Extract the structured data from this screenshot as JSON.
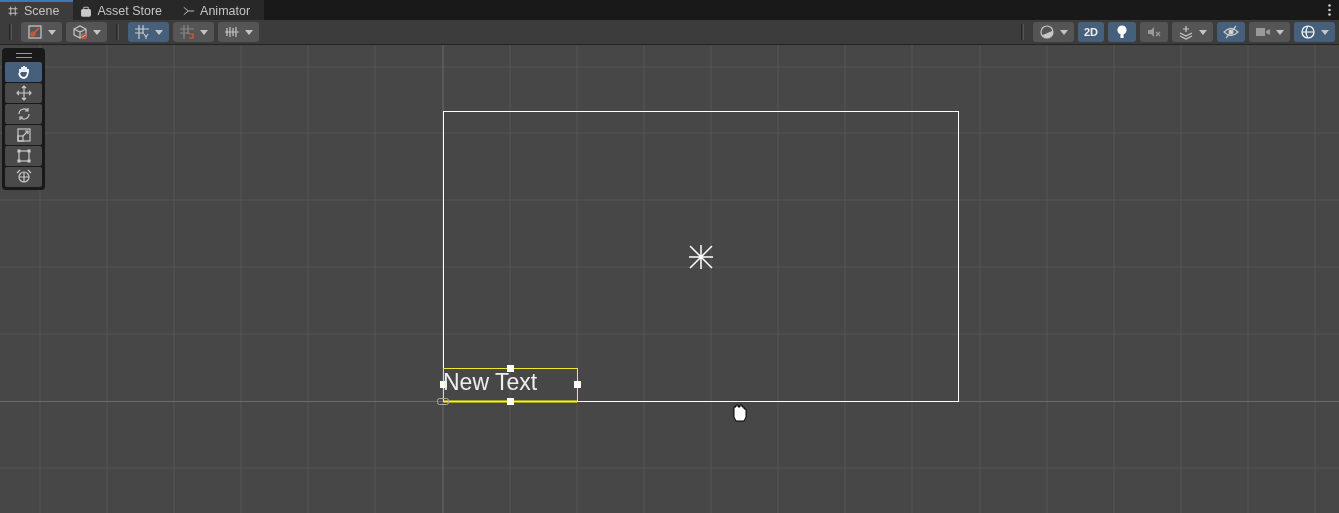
{
  "tabs": [
    {
      "label": "Scene",
      "selected": true
    },
    {
      "label": "Asset Store",
      "selected": false
    },
    {
      "label": "Animator",
      "selected": false
    }
  ],
  "toolbar_left": [
    {
      "selected": false,
      "dropdown": true
    },
    {
      "selected": false,
      "dropdown": true
    },
    {
      "selected": true,
      "dropdown": true
    },
    {
      "selected": false,
      "dropdown": true
    },
    {
      "selected": false,
      "dropdown": true
    }
  ],
  "toolbar_right": [
    {
      "selected": false,
      "dropdown": true
    },
    {
      "label": "2D",
      "selected": true,
      "dropdown": false
    },
    {
      "selected": true,
      "dropdown": false
    },
    {
      "selected": false,
      "dropdown": false
    },
    {
      "selected": false,
      "dropdown": true
    },
    {
      "selected": true,
      "dropdown": false
    },
    {
      "selected": false,
      "dropdown": true
    },
    {
      "selected": true,
      "dropdown": true
    }
  ],
  "tools": [
    {
      "selected": true
    },
    {
      "selected": false
    },
    {
      "selected": false
    },
    {
      "selected": false
    },
    {
      "selected": false
    },
    {
      "selected": false
    }
  ],
  "scene": {
    "text_object": "New Text"
  }
}
